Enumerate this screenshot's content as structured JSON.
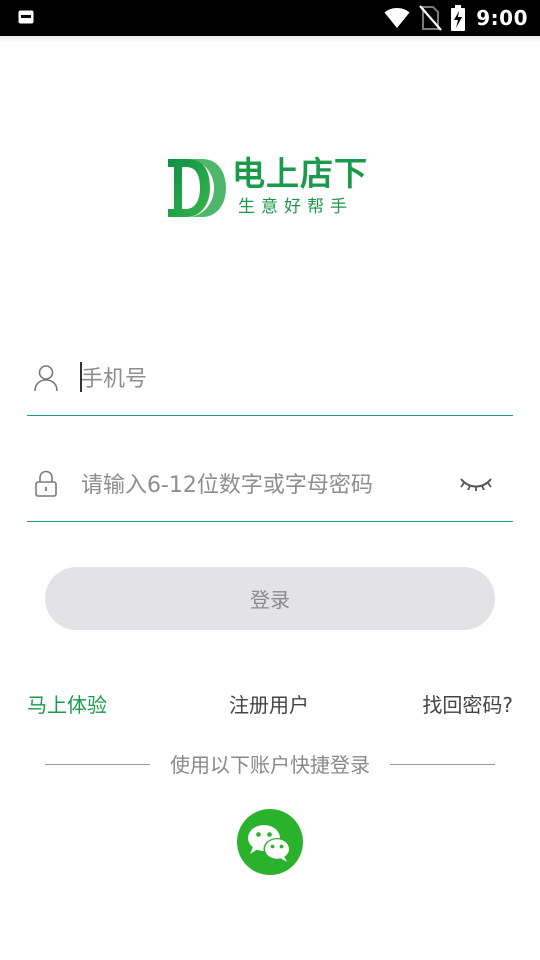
{
  "status_bar": {
    "time": "9:00",
    "icons": [
      "notification-icon",
      "wifi-icon",
      "no-sim-icon",
      "battery-charging-icon"
    ]
  },
  "logo": {
    "title": "电上店下",
    "slogan": "生意好帮手",
    "brand_color": "#1a9a4b"
  },
  "form": {
    "phone_placeholder": "手机号",
    "password_placeholder": "请输入6-12位数字或字母密码",
    "login_label": "登录",
    "underline_color": "#1c9a8a"
  },
  "links": {
    "try_now": "马上体验",
    "register": "注册用户",
    "forgot_password": "找回密码?"
  },
  "quick_login": {
    "label": "使用以下账户快捷登录",
    "wechat_icon": "wechat-icon",
    "wechat_color": "#2bb22d"
  }
}
